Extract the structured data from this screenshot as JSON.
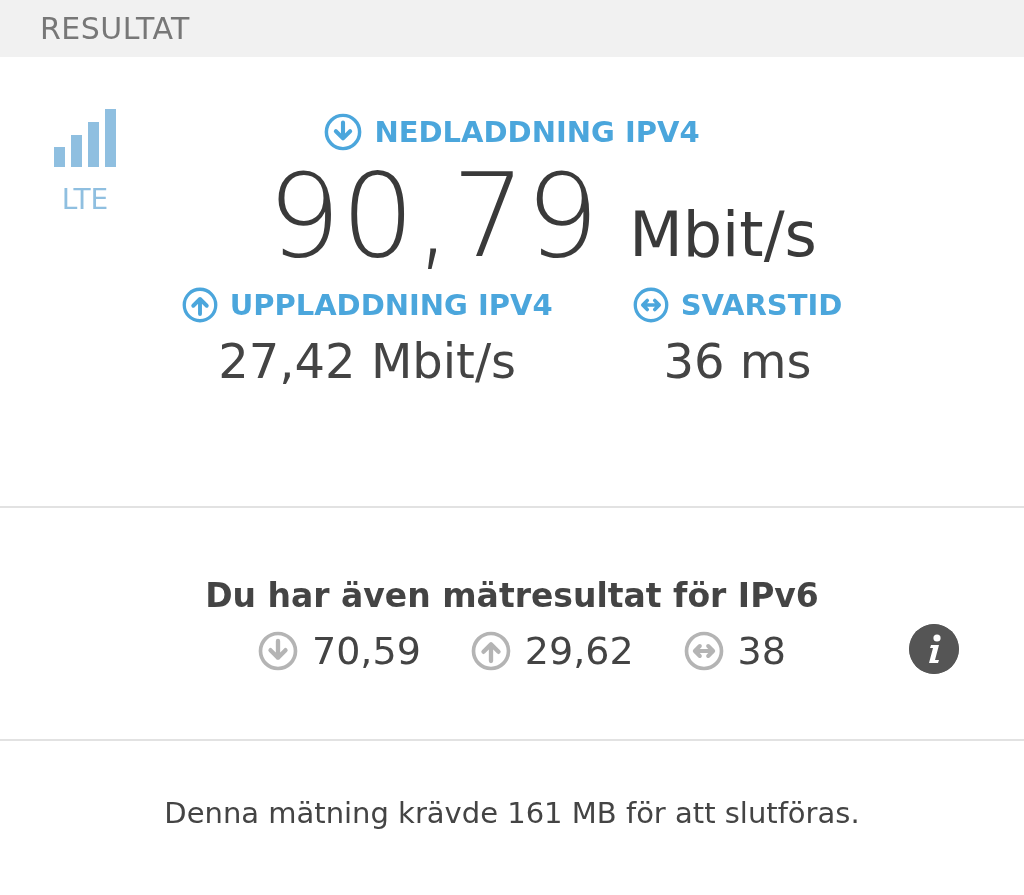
{
  "header": {
    "title": "RESULTAT"
  },
  "network": {
    "type": "LTE"
  },
  "download": {
    "kind": "download",
    "label": "NEDLADDNING IPV4",
    "value": "90,79",
    "unit": "Mbit/s"
  },
  "metrics": [
    {
      "kind": "upload",
      "label": "UPPLADDNING IPV4",
      "value": "27,42 Mbit/s"
    },
    {
      "kind": "ping",
      "label": "SVARSTID",
      "value": "36 ms"
    }
  ],
  "ipv6": {
    "title": "Du har även mätresultat för IPv6",
    "values": [
      {
        "kind": "download",
        "value": "70,59"
      },
      {
        "kind": "upload",
        "value": "29,62"
      },
      {
        "kind": "ping",
        "value": "38"
      }
    ]
  },
  "footer": "Denna mätning krävde 161 MB för att slutföras."
}
